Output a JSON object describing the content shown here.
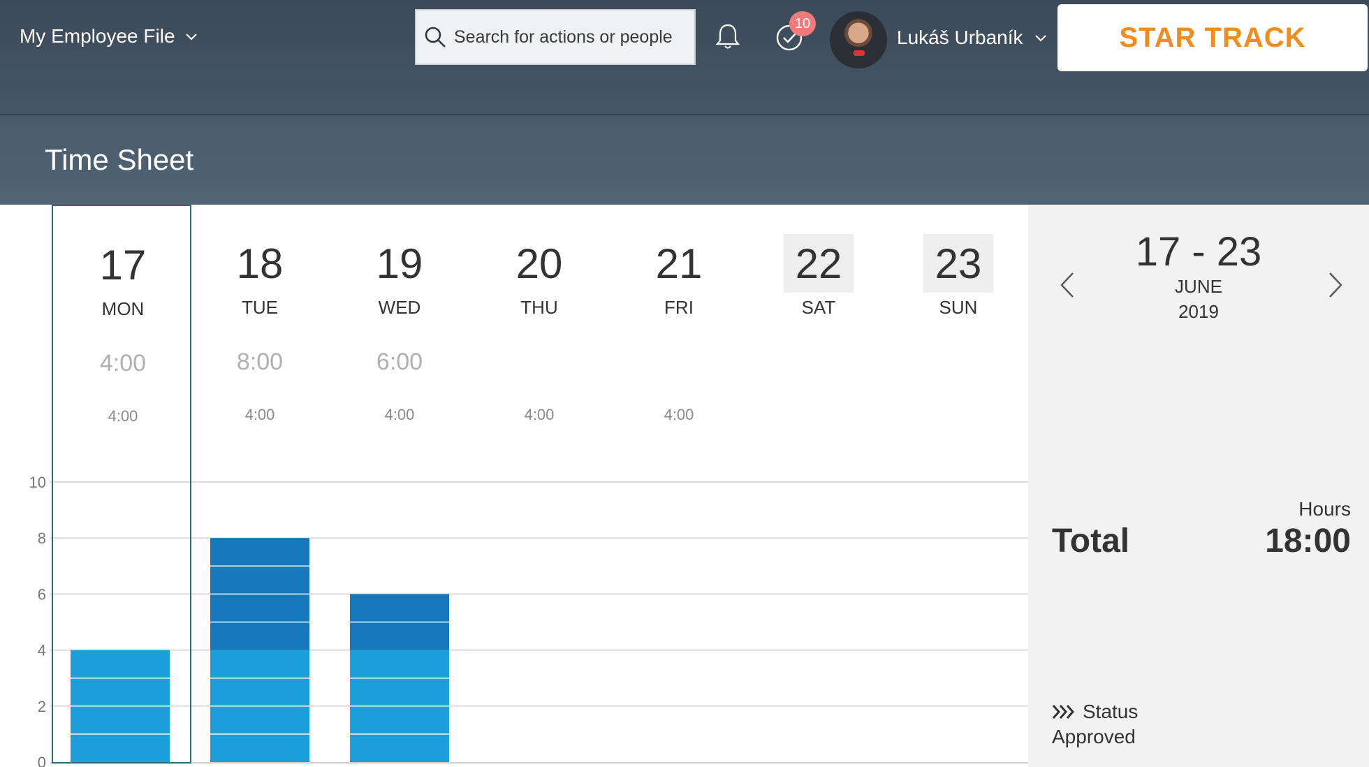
{
  "header": {
    "app_title": "My Employee File",
    "search_placeholder": "Search for actions or people",
    "tasks_badge": "10",
    "user_name": "Lukáš Urbaník",
    "brand": "STAR TRACK"
  },
  "page": {
    "title": "Time Sheet"
  },
  "days": [
    {
      "num": "17",
      "name": "MON",
      "total": "4:00",
      "target": "4:00",
      "weekend": false,
      "selected": true
    },
    {
      "num": "18",
      "name": "TUE",
      "total": "8:00",
      "target": "4:00",
      "weekend": false,
      "selected": false
    },
    {
      "num": "19",
      "name": "WED",
      "total": "6:00",
      "target": "4:00",
      "weekend": false,
      "selected": false
    },
    {
      "num": "20",
      "name": "THU",
      "total": "",
      "target": "4:00",
      "weekend": false,
      "selected": false
    },
    {
      "num": "21",
      "name": "FRI",
      "total": "",
      "target": "4:00",
      "weekend": false,
      "selected": false
    },
    {
      "num": "22",
      "name": "SAT",
      "total": "",
      "target": "",
      "weekend": true,
      "selected": false
    },
    {
      "num": "23",
      "name": "SUN",
      "total": "",
      "target": "",
      "weekend": true,
      "selected": false
    }
  ],
  "chart_data": {
    "type": "bar",
    "categories": [
      "MON",
      "TUE",
      "WED",
      "THU",
      "FRI",
      "SAT",
      "SUN"
    ],
    "series": [
      {
        "values": [
          4,
          4,
          4,
          0,
          0,
          0,
          0
        ],
        "color": "#1d9fdc"
      },
      {
        "values": [
          0,
          4,
          2,
          0,
          0,
          0,
          0
        ],
        "color": "#1478ba"
      }
    ],
    "ylim": [
      0,
      10
    ],
    "yticks": [
      "0",
      "2",
      "4",
      "6",
      "8",
      "10"
    ],
    "grid": true
  },
  "side": {
    "range": "17 - 23",
    "month": "JUNE",
    "year": "2019",
    "hours_label": "Hours",
    "total_label": "Total",
    "total_value": "18:00",
    "status_label": "Status",
    "status_value": "Approved"
  },
  "icons": {
    "search": "search-icon",
    "notifications": "bell-icon",
    "tasks": "check-circle-icon",
    "prev": "chevron-left-icon",
    "next": "chevron-right-icon",
    "status": "triple-chevron-icon"
  }
}
